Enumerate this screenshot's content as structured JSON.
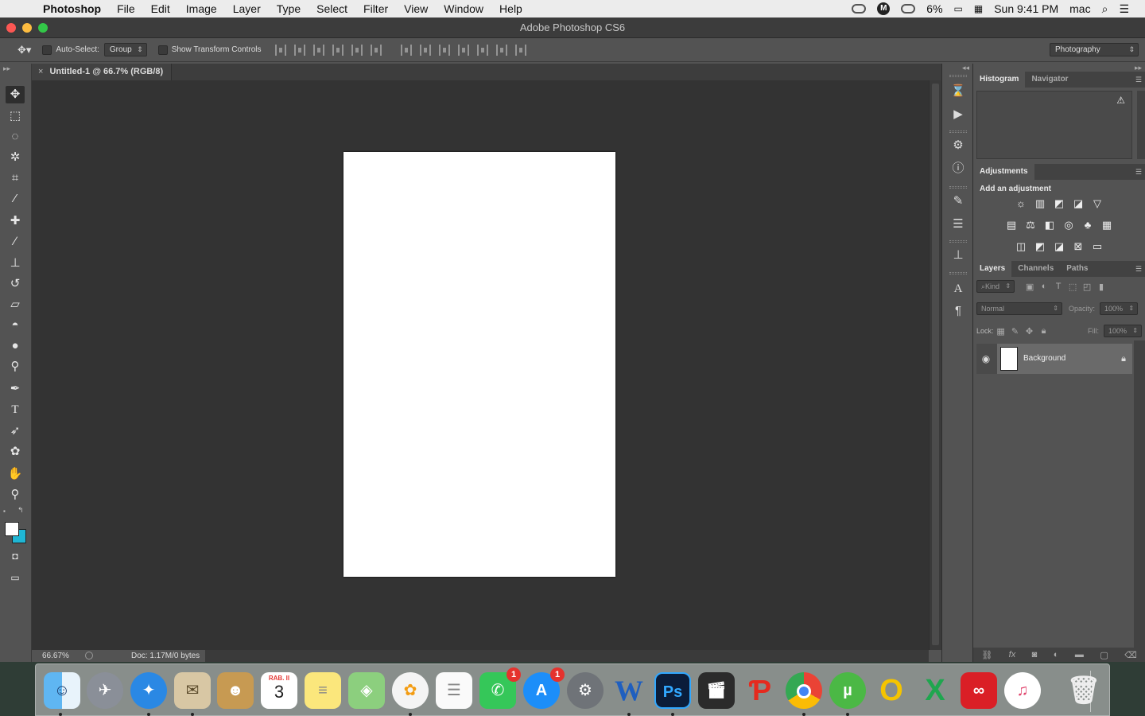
{
  "menubar": {
    "app_name": "Photoshop",
    "items": [
      "File",
      "Edit",
      "Image",
      "Layer",
      "Type",
      "Select",
      "Filter",
      "View",
      "Window",
      "Help"
    ],
    "status": {
      "m_label": "M",
      "battery": "6%",
      "clock": "Sun 9:41 PM",
      "user": "mac"
    }
  },
  "window": {
    "title": "Adobe Photoshop CS6"
  },
  "options": {
    "auto_select_label": "Auto-Select:",
    "auto_select_value": "Group",
    "transform_label": "Show Transform Controls",
    "workspace": "Photography"
  },
  "document": {
    "tab_label": "Untitled-1 @ 66.7% (RGB/8)",
    "tab_close": "×",
    "zoom": "66.67%",
    "doc_info": "Doc: 1.17M/0 bytes",
    "canvas_color": "#ffffff"
  },
  "panels": {
    "top_tabs": [
      "Histogram",
      "Navigator"
    ],
    "adjustments_tab": "Adjustments",
    "adjustments_header": "Add an adjustment",
    "layers_tabs": [
      "Layers",
      "Channels",
      "Paths"
    ],
    "kind_filter": "Kind",
    "blend_mode": "Normal",
    "opacity_label": "Opacity:",
    "opacity_value": "100%",
    "lock_label": "Lock:",
    "fill_label": "Fill:",
    "fill_value": "100%",
    "layer_name": "Background"
  },
  "tools": [
    "move-tool",
    "marquee-tool",
    "lasso-tool",
    "quick-select-tool",
    "crop-tool",
    "eyedropper-tool",
    "spot-healing-tool",
    "brush-tool",
    "clone-stamp-tool",
    "history-brush-tool",
    "eraser-tool",
    "paint-bucket-tool",
    "blur-tool",
    "dodge-tool",
    "pen-tool",
    "type-tool",
    "path-selection-tool",
    "custom-shape-tool",
    "hand-tool",
    "zoom-tool"
  ],
  "colors": {
    "foreground": "#ffffff",
    "background": "#1fb6d4"
  },
  "dock": {
    "calendar_month": "RAB. II",
    "calendar_day": "3",
    "facetime_badge": "1",
    "appstore_badge": "1",
    "ps_label": "Ps",
    "word_label": "W"
  }
}
